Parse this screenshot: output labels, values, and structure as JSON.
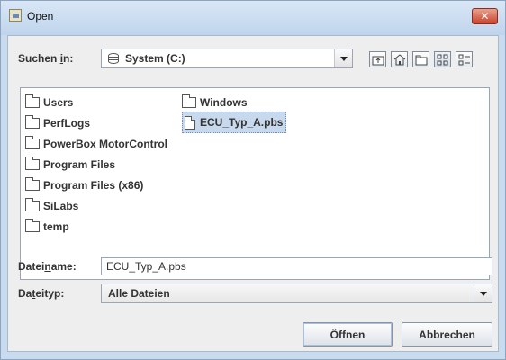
{
  "window": {
    "title": "Open",
    "close_glyph": "✕"
  },
  "lookin": {
    "label_prefix": "Suchen ",
    "label_mnemonic": "i",
    "label_suffix": "n:",
    "value": "System (C:)",
    "icon": "drive-icon"
  },
  "toolbar": [
    {
      "name": "up-one-level-button",
      "icon": "folder-up-icon"
    },
    {
      "name": "home-button",
      "icon": "home-icon"
    },
    {
      "name": "new-folder-button",
      "icon": "new-folder-icon"
    },
    {
      "name": "list-view-button",
      "icon": "list-view-icon"
    },
    {
      "name": "details-view-button",
      "icon": "details-view-icon"
    }
  ],
  "files": {
    "column1": [
      {
        "name": "Users",
        "type": "folder"
      },
      {
        "name": "PerfLogs",
        "type": "folder"
      },
      {
        "name": "PowerBox MotorControl",
        "type": "folder"
      },
      {
        "name": "Program Files",
        "type": "folder"
      },
      {
        "name": "Program Files (x86)",
        "type": "folder"
      },
      {
        "name": "SiLabs",
        "type": "folder"
      },
      {
        "name": "temp",
        "type": "folder"
      }
    ],
    "column2": [
      {
        "name": "Windows",
        "type": "folder"
      },
      {
        "name": "ECU_Typ_A.pbs",
        "type": "file",
        "selected": true
      }
    ]
  },
  "filename": {
    "label_prefix": "Datei",
    "label_mnemonic": "n",
    "label_suffix": "ame:",
    "value": "ECU_Typ_A.pbs"
  },
  "filetype": {
    "label_prefix": "Da",
    "label_mnemonic": "t",
    "label_suffix": "eityp:",
    "value": "Alle Dateien"
  },
  "buttons": {
    "open": "Öffnen",
    "cancel": "Abbrechen"
  }
}
